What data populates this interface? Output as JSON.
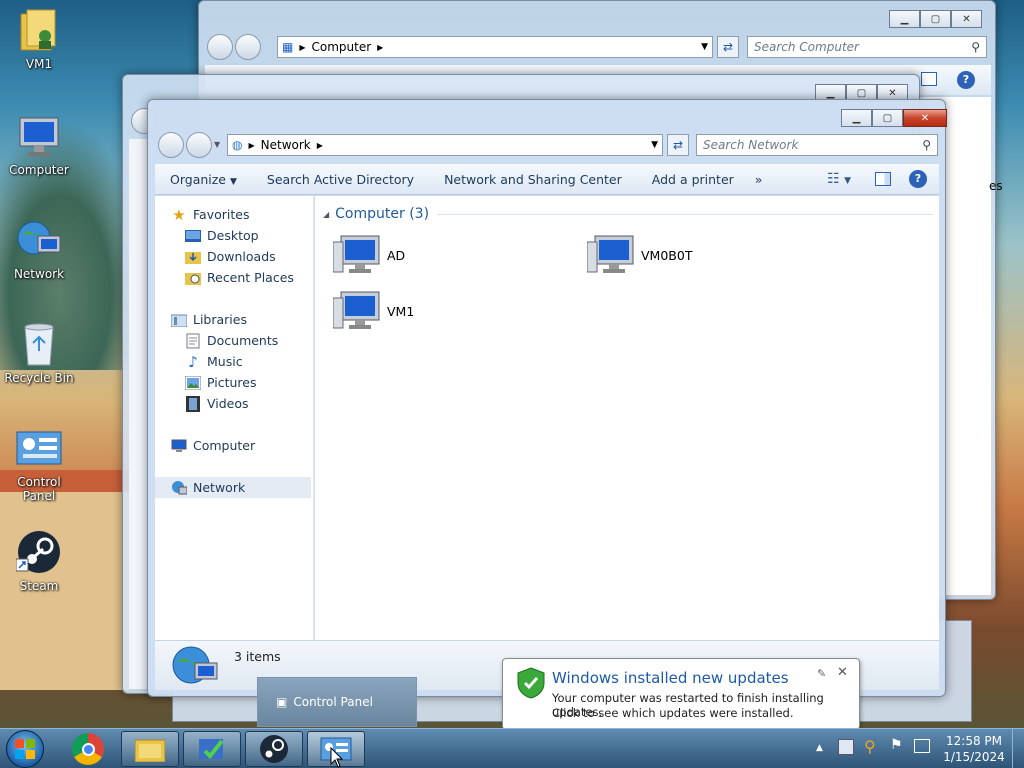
{
  "desktop_icons": [
    {
      "label": "VM1",
      "icon": "user-folder-icon"
    },
    {
      "label": "Computer",
      "icon": "computer-icon"
    },
    {
      "label": "Network",
      "icon": "network-icon"
    },
    {
      "label": "Recycle Bin",
      "icon": "recycle-bin-icon"
    },
    {
      "label": "Control Panel",
      "icon": "control-panel-icon"
    },
    {
      "label": "Steam",
      "icon": "steam-icon"
    }
  ],
  "back_window": {
    "breadcrumb": "Computer",
    "search_placeholder": "Search Computer",
    "partial_text": "es"
  },
  "main_window": {
    "breadcrumb": "Network",
    "search_placeholder": "Search Network",
    "toolbar": {
      "organize": "Organize",
      "search_ad": "Search Active Directory",
      "nsc": "Network and Sharing Center",
      "add_printer": "Add a printer",
      "more": "»"
    },
    "nav": {
      "favorites": "Favorites",
      "desktop": "Desktop",
      "downloads": "Downloads",
      "recent": "Recent Places",
      "libraries": "Libraries",
      "documents": "Documents",
      "music": "Music",
      "pictures": "Pictures",
      "videos": "Videos",
      "computer": "Computer",
      "network": "Network"
    },
    "group_header": "Computer (3)",
    "items": [
      "AD",
      "VM0B0T",
      "VM1"
    ],
    "status": "3 items"
  },
  "taskbar_tooltip": "Control Panel",
  "notification": {
    "title": "Windows installed new updates",
    "line1": "Your computer was restarted to finish installing updates.",
    "line2": "Click to see which updates were installed."
  },
  "clock": {
    "time": "12:58 PM",
    "date": "1/15/2024"
  },
  "colors": {
    "link": "#1e395b",
    "group_header": "#1e5a9c",
    "title_blue": "#1e5aa8"
  }
}
